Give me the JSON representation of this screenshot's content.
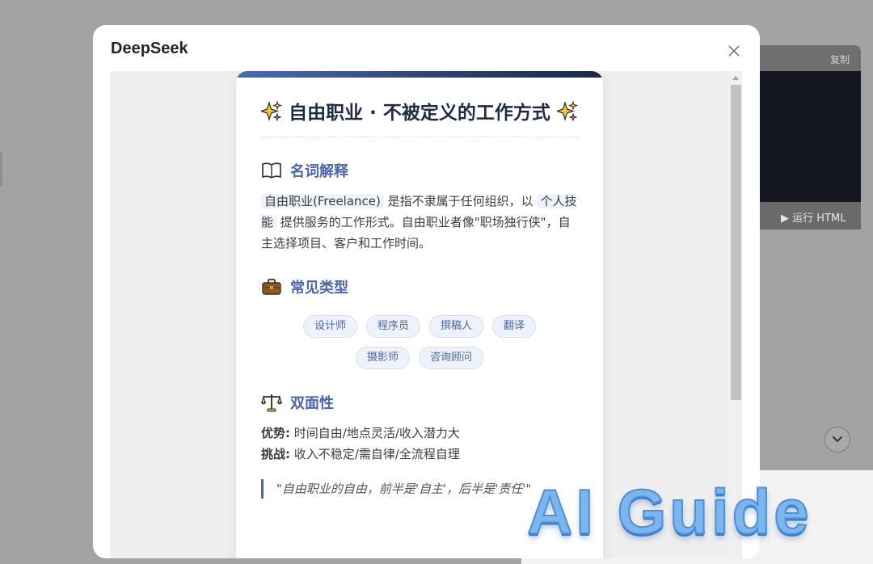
{
  "background": {
    "code_panel": {
      "copy_label": "复制",
      "run_label": "运行 HTML"
    }
  },
  "dialog": {
    "title": "DeepSeek"
  },
  "card": {
    "title_text": "自由职业 · 不被定义的工作方式",
    "sections": {
      "definition": {
        "heading": "名词解释",
        "term": "自由职业(Freelance)",
        "text_a": " 是指不隶属于任何组织，以 ",
        "term2": "个人技能",
        "text_b": " 提供服务的工作形式。自由职业者像\"职场独行侠\"，自主选择项目、客户和工作时间。"
      },
      "types": {
        "heading": "常见类型",
        "tags": [
          "设计师",
          "程序员",
          "撰稿人",
          "翻译",
          "摄影师",
          "咨询顾问"
        ]
      },
      "duality": {
        "heading": "双面性",
        "pros_label": "优势:",
        "pros_text": " 时间自由/地点灵活/收入潜力大",
        "cons_label": "挑战:",
        "cons_text": " 收入不稳定/需自律/全流程自理",
        "quote": "\"自由职业的自由，前半是'自主'，后半是'责任'\""
      }
    }
  },
  "watermark": "AI Guide",
  "colors": {
    "accent": "#4b66ab",
    "title": "#1f2a44",
    "tag_bg": "#eef2fb"
  }
}
